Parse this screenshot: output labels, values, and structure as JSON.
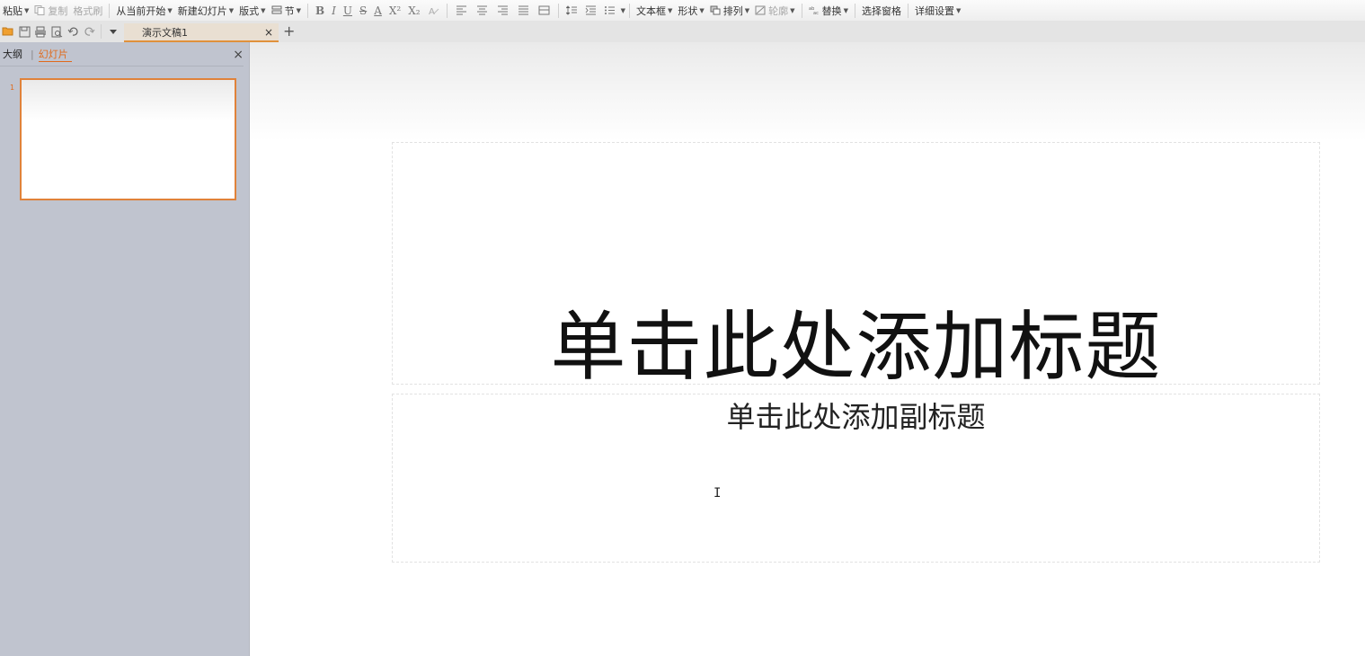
{
  "ribbon": {
    "paste": "粘贴",
    "copy": "复制",
    "format_painter": "格式刷",
    "from_current": "从当前开始",
    "new_slide": "新建幻灯片",
    "layout": "版式",
    "section": "节",
    "bold": "B",
    "italic": "I",
    "underline": "U",
    "strike": "S",
    "font_color": "A",
    "superscript": "X²",
    "subscript": "X₂",
    "textbox": "文本框",
    "shape": "形状",
    "arrange": "排列",
    "outline": "轮廓",
    "replace": "替换",
    "selection_pane": "选择窗格",
    "detail_settings": "详细设置"
  },
  "tabs": {
    "doc_title": "演示文稿1",
    "close_glyph": "×",
    "new_tab_glyph": "+"
  },
  "left_pane": {
    "tab_outline": "大纲",
    "tab_slides": "幻灯片",
    "close_glyph": "×",
    "slide_number": "1"
  },
  "slide": {
    "title_placeholder": "单击此处添加标题",
    "subtitle_placeholder": "单击此处添加副标题",
    "cursor_glyph": "I"
  },
  "colors": {
    "accent": "#e06a1b",
    "pane_bg": "#c0c4cf"
  }
}
